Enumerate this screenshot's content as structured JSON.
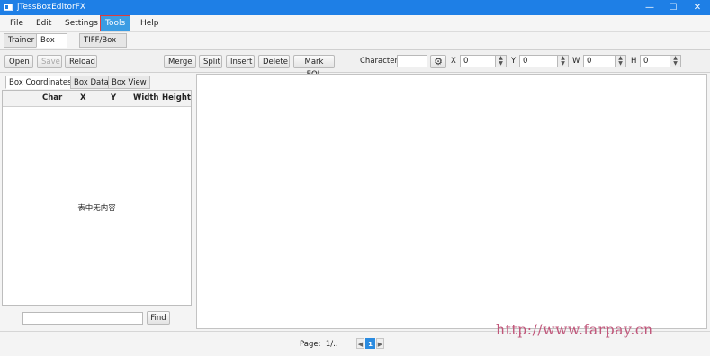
{
  "window": {
    "title": "jTessBoxEditorFX",
    "minimize": "—",
    "maximize": "☐",
    "close": "✕"
  },
  "menus": [
    "File",
    "Edit",
    "Settings",
    "Tools",
    "Help"
  ],
  "tabs": [
    "Trainer",
    "Box Editor",
    "TIFF/Box Generator"
  ],
  "toolbar": {
    "open": "Open",
    "save": "Save",
    "reload": "Reload",
    "merge": "Merge",
    "split": "Split",
    "insert": "Insert",
    "delete": "Delete",
    "mark_eol": "Mark EOL",
    "character_label": "Character",
    "character_value": "",
    "x_label": "X",
    "x_value": "0",
    "y_label": "Y",
    "y_value": "0",
    "w_label": "W",
    "w_value": "0",
    "h_label": "H",
    "h_value": "0"
  },
  "left_tabs": [
    "Box Coordinates",
    "Box Data",
    "Box View"
  ],
  "table": {
    "columns": [
      "Char",
      "X",
      "Y",
      "Width",
      "Height"
    ],
    "empty_text": "表中无内容"
  },
  "find": {
    "button": "Find",
    "value": ""
  },
  "status": {
    "page_label": "Page:",
    "page_value": "1/..",
    "current_page": "1",
    "prev": "◀",
    "next": "▶"
  },
  "watermark": "http://www.farpay.cn",
  "colors": {
    "titlebar": "#1e7fe6",
    "active_menu": "#3b9ce3",
    "highlight_outline": "#e03c3c",
    "watermark": "#c0567a"
  }
}
